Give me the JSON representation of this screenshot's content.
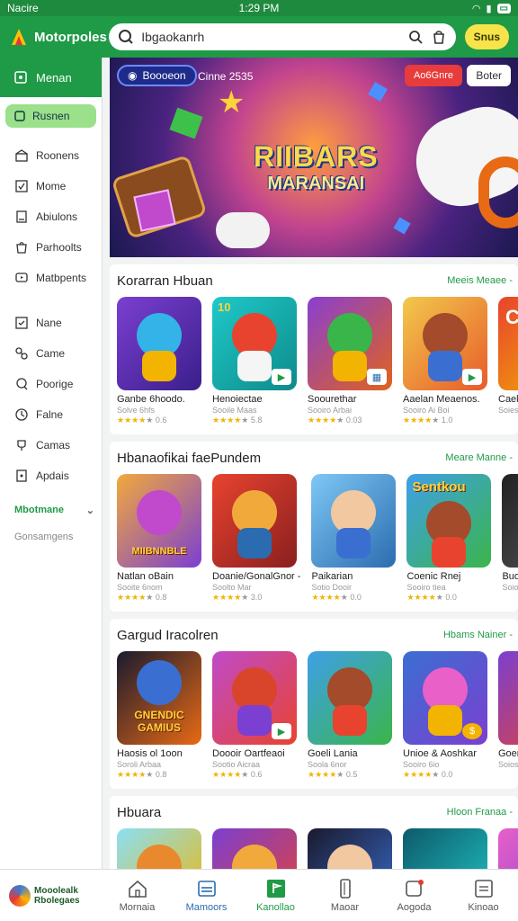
{
  "status_bar": {
    "carrier": "Nacire",
    "time": "1:29 PM"
  },
  "app_bar": {
    "brand": "Motorpoles",
    "search_value": "Ibgaokanrh",
    "primary_button": "Snus"
  },
  "sidebar": {
    "header": "Menan",
    "chip": "Rusnen",
    "items": [
      {
        "label": "Roonens",
        "icon": "gift-icon"
      },
      {
        "label": "Mome",
        "icon": "check-box-icon"
      },
      {
        "label": "Abiulons",
        "icon": "bookmark-icon"
      },
      {
        "label": "Parhoolts",
        "icon": "bag-icon"
      },
      {
        "label": "Matbpents",
        "icon": "tv-icon"
      }
    ],
    "items2": [
      {
        "label": "Nane",
        "icon": "checklist-icon"
      },
      {
        "label": "Came",
        "icon": "puzzle-icon"
      },
      {
        "label": "Poorige",
        "icon": "chat-icon"
      },
      {
        "label": "Falne",
        "icon": "clock-icon"
      },
      {
        "label": "Camas",
        "icon": "trophy-icon"
      },
      {
        "label": "Apdais",
        "icon": "file-icon"
      }
    ],
    "section_label": "Mbotmane",
    "section_sub": "Gonsamgens"
  },
  "banner": {
    "pill": "Boooeon",
    "subtitle": "Cinne 2535",
    "red_button": "Ao6Gnre",
    "white_button": "Boter",
    "title_line1": "RIIBARS",
    "title_line2": "MARANSAI"
  },
  "sections": [
    {
      "title": "Korarran Hbuan",
      "more": "Meeis Meaee -",
      "cards": [
        {
          "name": "Ganbe 6hoodo.",
          "sub": "Solve 6hfs",
          "rating": "0.6",
          "label": ""
        },
        {
          "name": "Henoiectae",
          "sub": "Sooile Maas",
          "rating": "5.8",
          "label": "10"
        },
        {
          "name": "Soourethar",
          "sub": "Sooiro Arbai",
          "rating": "0.03",
          "label": ""
        },
        {
          "name": "Aaelan Meaenos.",
          "sub": "Sooiro Ai Boi",
          "rating": "1.0",
          "label": ""
        },
        {
          "name": "Caeka I",
          "sub": "Soies",
          "rating": "",
          "label": "C"
        }
      ]
    },
    {
      "title": "Hbanaofikai faePundem",
      "more": "Meare Manne -",
      "cards": [
        {
          "name": "Natlan oBain",
          "sub": "Sooite 6nom",
          "rating": "0.8",
          "label": "MIIBNNBLE"
        },
        {
          "name": "Doanie/GonalGnor -",
          "sub": "Soolto Mar",
          "rating": "3.0",
          "label": ""
        },
        {
          "name": "Paikarian",
          "sub": "Sotio Dooir",
          "rating": "0.0",
          "label": ""
        },
        {
          "name": "Coenic Rnej",
          "sub": "Sooiro tiea",
          "rating": "0.0",
          "label": "Sentkou"
        },
        {
          "name": "Buoga",
          "sub": "Soios",
          "rating": "",
          "label": ""
        }
      ]
    },
    {
      "title": "Gargud Iracolren",
      "more": "Hbams Nainer -",
      "cards": [
        {
          "name": "Haosis ol 1oon",
          "sub": "Soroli Arbaa",
          "rating": "0.8",
          "label": "GNENDIC GAMIUS"
        },
        {
          "name": "Doooir Oartfeaoi",
          "sub": "Sootio Aicraa",
          "rating": "0.6",
          "label": ""
        },
        {
          "name": "Goeli Lania",
          "sub": "Soola 6nor",
          "rating": "0.5",
          "label": ""
        },
        {
          "name": "Unioe & Aoshkar",
          "sub": "Sooiro 6io",
          "rating": "0.0",
          "label": ""
        },
        {
          "name": "Goeno",
          "sub": "Soios",
          "rating": "",
          "label": ""
        }
      ]
    },
    {
      "title": "Hbuara",
      "more": "Hloon Franaa -",
      "cards": [
        {
          "name": "",
          "sub": "",
          "rating": "",
          "label": ""
        },
        {
          "name": "",
          "sub": "",
          "rating": "",
          "label": ""
        },
        {
          "name": "",
          "sub": "",
          "rating": "",
          "label": ""
        },
        {
          "name": "",
          "sub": "",
          "rating": "",
          "label": ""
        },
        {
          "name": "",
          "sub": "",
          "rating": "",
          "label": ""
        }
      ]
    }
  ],
  "bottom_nav": {
    "brand_line1": "Mooolealk",
    "brand_line2": "Rbolegaes",
    "items": [
      {
        "label": "Mornaia",
        "icon": "home-icon"
      },
      {
        "label": "Mamoors",
        "icon": "window-icon"
      },
      {
        "label": "Kanollao",
        "icon": "flag-icon"
      },
      {
        "label": "Maoar",
        "icon": "phone-icon"
      },
      {
        "label": "Aogoda",
        "icon": "notification-icon"
      },
      {
        "label": "Kinoao",
        "icon": "list-box-icon"
      }
    ]
  }
}
